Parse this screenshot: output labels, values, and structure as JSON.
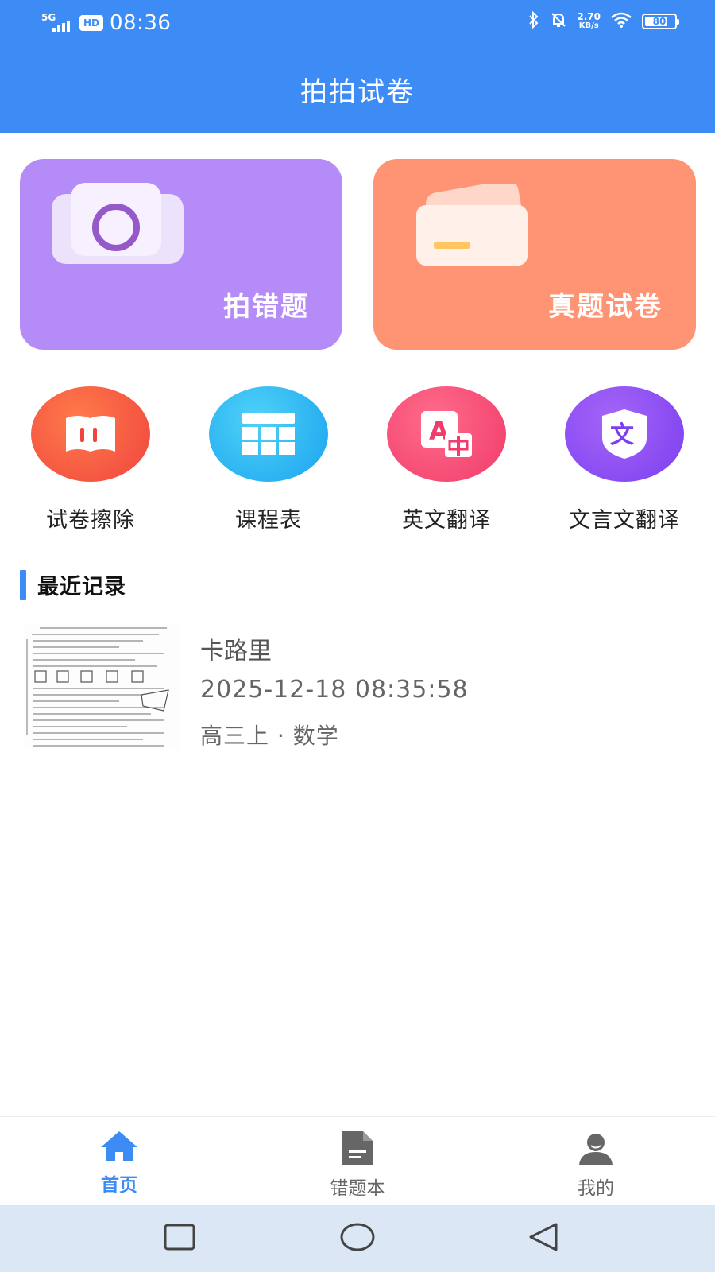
{
  "status_bar": {
    "network": "5G",
    "hd_badge": "HD",
    "time": "08:36",
    "speed_value": "2.70",
    "speed_unit": "KB/s",
    "battery": "80",
    "battery_level_percent": 80
  },
  "header": {
    "title": "拍拍试卷"
  },
  "cards": [
    {
      "label": "拍错题",
      "color": "#b58bf8",
      "icon": "camera-icon"
    },
    {
      "label": "真题试卷",
      "color": "#ff9475",
      "icon": "card-icon"
    }
  ],
  "shortcuts": [
    {
      "label": "试卷擦除",
      "icon": "eraser-book-icon"
    },
    {
      "label": "课程表",
      "icon": "table-icon"
    },
    {
      "label": "英文翻译",
      "icon": "translate-icon"
    },
    {
      "label": "文言文翻译",
      "icon": "classical-text-icon"
    }
  ],
  "recent": {
    "title": "最近记录",
    "items": [
      {
        "title": "卡路里",
        "time": "2025-12-18 08:35:58",
        "meta": "高三上 · 数学"
      }
    ]
  },
  "bottom_nav": {
    "items": [
      {
        "label": "首页",
        "icon": "home-icon",
        "active": true
      },
      {
        "label": "错题本",
        "icon": "document-icon",
        "active": false
      },
      {
        "label": "我的",
        "icon": "user-icon",
        "active": false
      }
    ]
  },
  "colors": {
    "accent": "#3d8cf5",
    "card_purple": "#b58bf8",
    "card_orange": "#ff9475",
    "system_nav": "#dbe7f4"
  }
}
